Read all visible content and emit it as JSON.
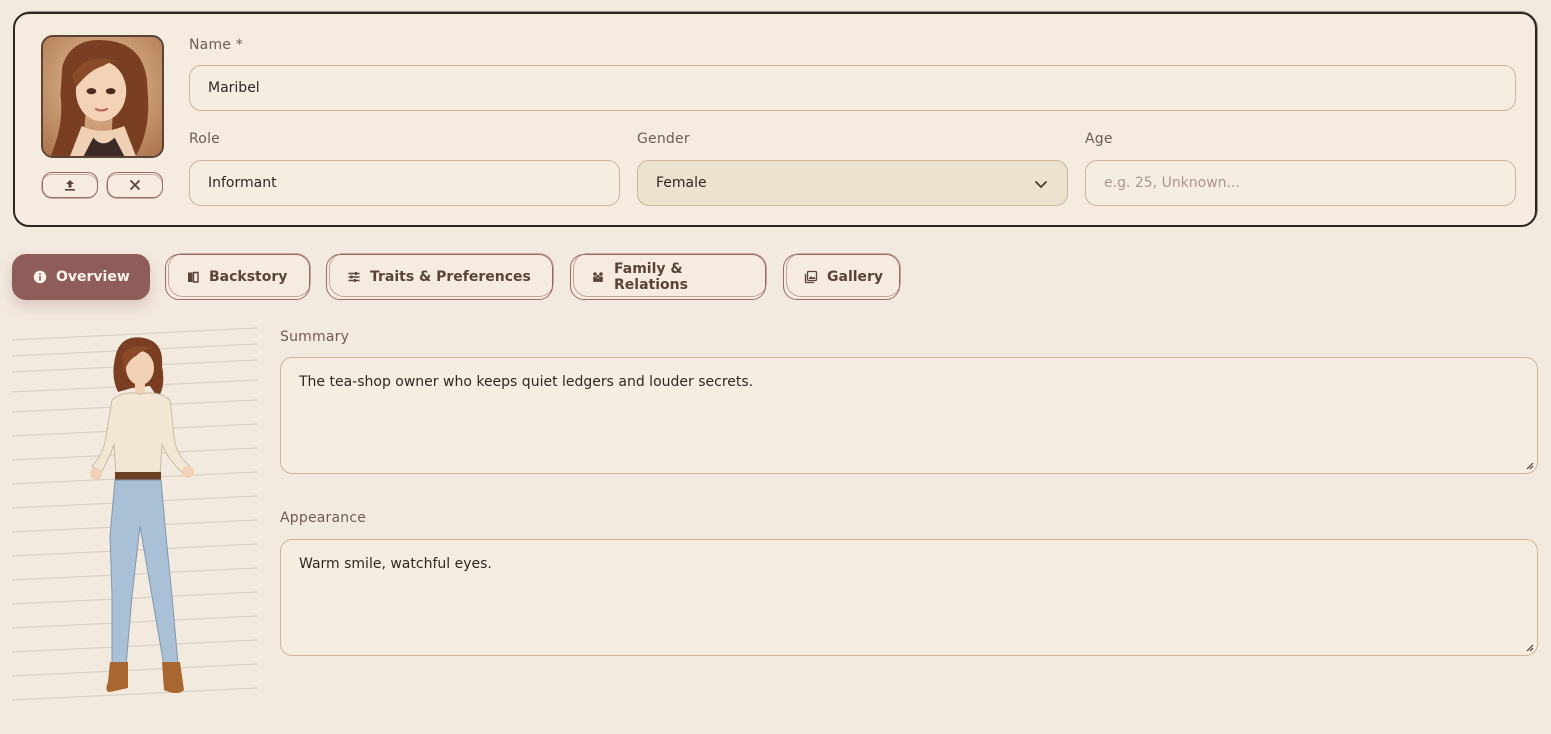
{
  "profile": {
    "name_label": "Name *",
    "name_value": "Maribel",
    "role_label": "Role",
    "role_value": "Informant",
    "gender_label": "Gender",
    "gender_value": "Female",
    "age_label": "Age",
    "age_placeholder": "e.g. 25, Unknown...",
    "avatar_actions": [
      {
        "icon": "upload-icon"
      },
      {
        "icon": "close-icon"
      }
    ]
  },
  "tabs": [
    {
      "label": "Overview",
      "icon": "info-icon",
      "active": true
    },
    {
      "label": "Backstory",
      "icon": "book-icon",
      "active": false
    },
    {
      "label": "Traits & Preferences",
      "icon": "sliders-icon",
      "active": false
    },
    {
      "label": "Family & Relations",
      "icon": "people-icon",
      "active": false
    },
    {
      "label": "Gallery",
      "icon": "image-icon",
      "active": false
    }
  ],
  "overview": {
    "summary_label": "Summary",
    "summary_value": "The tea-shop owner who keeps quiet ledgers and louder secrets.",
    "appearance_label": "Appearance",
    "appearance_value": "Warm smile, watchful eyes."
  },
  "colors": {
    "background": "#f3eadf",
    "accent": "#8e5d5a",
    "border": "#cbb59c",
    "text": "#2f2622"
  }
}
